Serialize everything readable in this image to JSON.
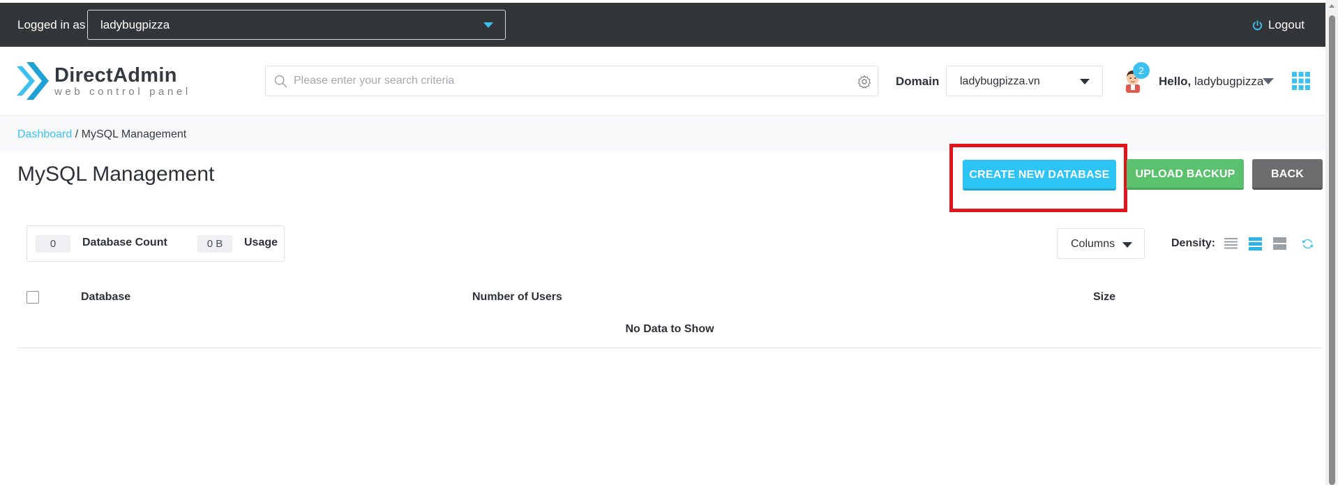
{
  "topbar": {
    "logged_in_label": "Logged in as",
    "user_value": "ladybugpizza",
    "logout_label": "Logout"
  },
  "header": {
    "brand_name": "DirectAdmin",
    "brand_tagline": "web control panel",
    "search_placeholder": "Please enter your search criteria",
    "domain_label": "Domain",
    "domain_value": "ladybugpizza.vn",
    "notification_count": "2",
    "hello_label": "Hello,",
    "hello_user": "ladybugpizza"
  },
  "breadcrumb": {
    "root": "Dashboard",
    "separator": " / ",
    "current": "MySQL Management"
  },
  "page": {
    "title": "MySQL Management",
    "create_button": "CREATE NEW DATABASE",
    "upload_button": "UPLOAD BACKUP",
    "back_button": "BACK"
  },
  "stats": {
    "database_count_value": "0",
    "database_count_label": "Database Count",
    "usage_value": "0 B",
    "usage_label": "Usage"
  },
  "table_controls": {
    "columns_label": "Columns",
    "density_label": "Density:"
  },
  "table": {
    "headers": [
      "Database",
      "Number of Users",
      "Size"
    ],
    "empty_message": "No Data to Show"
  },
  "colors": {
    "topbar": "#333639",
    "accent": "#3cc1f1",
    "create_button": "#2bc4f5",
    "upload_button": "#5cc16f",
    "back_button": "#6c6d6f",
    "highlight": "#e0141a"
  },
  "icons": [
    "power-icon",
    "search-icon",
    "gear-icon",
    "avatar",
    "apps-grid-icon",
    "density-compact-icon",
    "density-normal-icon",
    "density-comfortable-icon",
    "refresh-icon"
  ]
}
